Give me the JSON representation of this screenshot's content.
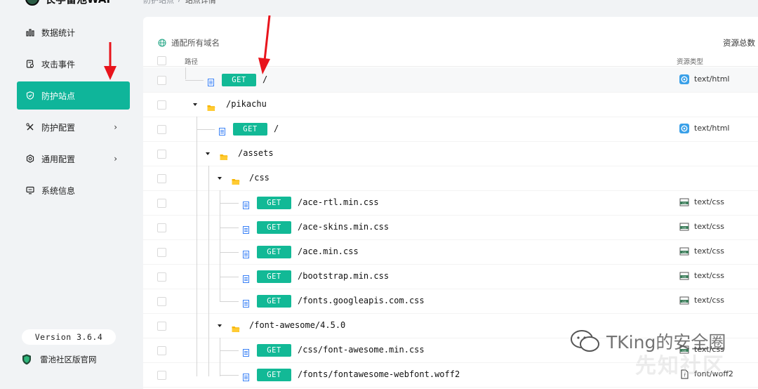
{
  "app": {
    "logo_text": "长亭雷池WAF"
  },
  "breadcrumb": {
    "parent": "防护站点",
    "sep": "/",
    "current": "站点详情"
  },
  "sidebar": {
    "items": [
      {
        "label": "数据统计",
        "icon": "bar-chart-icon",
        "active": false,
        "has_submenu": false
      },
      {
        "label": "攻击事件",
        "icon": "event-icon",
        "active": false,
        "has_submenu": false
      },
      {
        "label": "防护站点",
        "icon": "shield-icon",
        "active": true,
        "has_submenu": false
      },
      {
        "label": "防护配置",
        "icon": "tools-icon",
        "active": false,
        "has_submenu": true
      },
      {
        "label": "通用配置",
        "icon": "hexagon-gear-icon",
        "active": false,
        "has_submenu": true
      },
      {
        "label": "系统信息",
        "icon": "monitor-icon",
        "active": false,
        "has_submenu": false
      }
    ],
    "chevron": "›",
    "version": "Version 3.6.4",
    "community_link": "雷池社区版官网"
  },
  "main": {
    "domain_filter": "通配所有域名",
    "total_label": "资源总数",
    "columns": {
      "path": "路径",
      "resource_type": "资源类型"
    },
    "rows": [
      {
        "kind": "file",
        "depth": 1,
        "method": "GET",
        "path": "/",
        "type": "text/html",
        "type_icon": "html-icon",
        "highlighted": true
      },
      {
        "kind": "folder",
        "depth": 1,
        "path": "/pikachu"
      },
      {
        "kind": "file",
        "depth": 2,
        "method": "GET",
        "path": "/",
        "type": "text/html",
        "type_icon": "html-icon"
      },
      {
        "kind": "folder",
        "depth": 2,
        "path": "/assets"
      },
      {
        "kind": "folder",
        "depth": 3,
        "path": "/css"
      },
      {
        "kind": "file",
        "depth": 4,
        "method": "GET",
        "path": "/ace-rtl.min.css",
        "type": "text/css",
        "type_icon": "css-icon"
      },
      {
        "kind": "file",
        "depth": 4,
        "method": "GET",
        "path": "/ace-skins.min.css",
        "type": "text/css",
        "type_icon": "css-icon"
      },
      {
        "kind": "file",
        "depth": 4,
        "method": "GET",
        "path": "/ace.min.css",
        "type": "text/css",
        "type_icon": "css-icon"
      },
      {
        "kind": "file",
        "depth": 4,
        "method": "GET",
        "path": "/bootstrap.min.css",
        "type": "text/css",
        "type_icon": "css-icon"
      },
      {
        "kind": "file",
        "depth": 4,
        "method": "GET",
        "path": "/fonts.googleapis.com.css",
        "type": "text/css",
        "type_icon": "css-icon"
      },
      {
        "kind": "folder",
        "depth": 3,
        "path": "/font-awesome/4.5.0"
      },
      {
        "kind": "file",
        "depth": 4,
        "method": "GET",
        "path": "/css/font-awesome.min.css",
        "type": "text/css",
        "type_icon": "css-icon"
      },
      {
        "kind": "file",
        "depth": 4,
        "method": "GET",
        "path": "/fonts/fontawesome-webfont.woff2",
        "type": "font/woff2",
        "type_icon": "font-file-icon"
      }
    ]
  },
  "watermark": {
    "text": "TKing的安全圈",
    "text2": "先知社区"
  },
  "colors": {
    "accent": "#0fb59a",
    "get_badge": "#12b996",
    "annotation_arrow": "#e8141c"
  }
}
